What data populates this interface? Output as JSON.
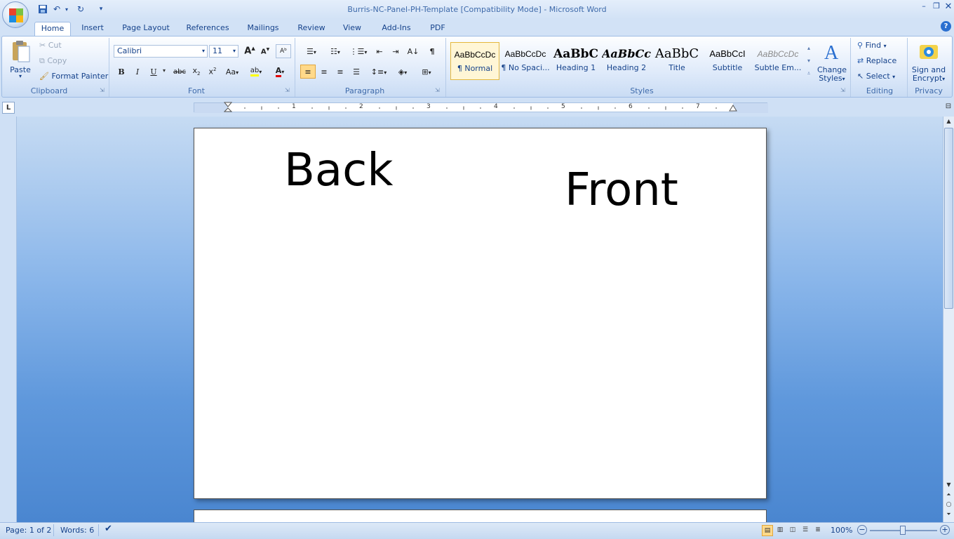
{
  "window": {
    "title": "Burris-NC-Panel-PH-Template [Compatibility Mode] - Microsoft Word"
  },
  "tabs": [
    "Home",
    "Insert",
    "Page Layout",
    "References",
    "Mailings",
    "Review",
    "View",
    "Add-Ins",
    "PDF"
  ],
  "clipboard": {
    "group": "Clipboard",
    "paste": "Paste",
    "cut": "Cut",
    "copy": "Copy",
    "format_painter": "Format Painter"
  },
  "font": {
    "group": "Font",
    "font_name": "Calibri",
    "font_size": "11"
  },
  "paragraph": {
    "group": "Paragraph"
  },
  "styles": {
    "group": "Styles",
    "items": [
      {
        "sample": "AaBbCcDc",
        "name": "¶ Normal"
      },
      {
        "sample": "AaBbCcDc",
        "name": "¶ No Spaci..."
      },
      {
        "sample": "AaBbC",
        "name": "Heading 1"
      },
      {
        "sample": "AaBbCc",
        "name": "Heading 2"
      },
      {
        "sample": "AaBbC",
        "name": "Title"
      },
      {
        "sample": "AaBbCcI",
        "name": "Subtitle"
      },
      {
        "sample": "AaBbCcDc",
        "name": "Subtle Em..."
      }
    ],
    "change_styles_line1": "Change",
    "change_styles_line2": "Styles"
  },
  "editing": {
    "group": "Editing",
    "find": "Find",
    "replace": "Replace",
    "select": "Select"
  },
  "privacy": {
    "group": "Privacy",
    "sign_line1": "Sign and",
    "sign_line2": "Encrypt"
  },
  "ruler": {
    "numbers": [
      "1",
      "2",
      "3",
      "4",
      "5",
      "6",
      "7"
    ]
  },
  "document": {
    "text_back": "Back",
    "text_front": "Front"
  },
  "status": {
    "page": "Page: 1 of 2",
    "words": "Words: 6",
    "zoom": "100%"
  },
  "colors": {
    "accent": "#15428b",
    "ribbon_border": "#9ebbe3",
    "workspace": "#5f98dc"
  }
}
